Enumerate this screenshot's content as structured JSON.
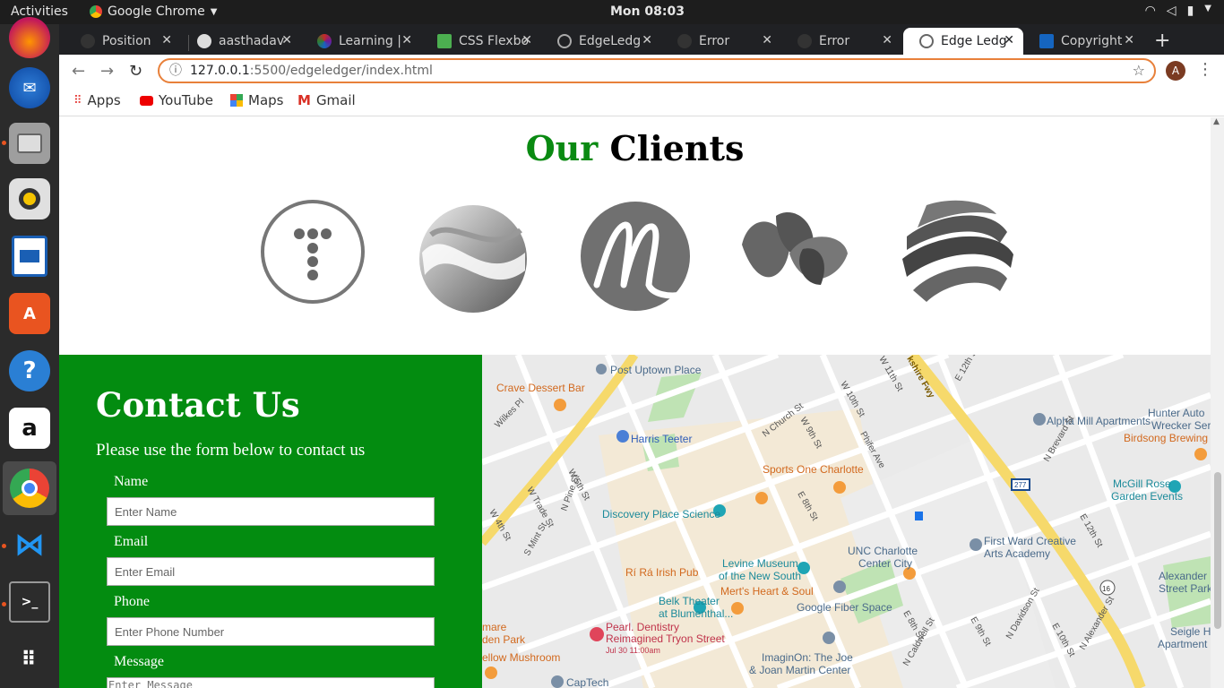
{
  "topbar": {
    "activities": "Activities",
    "app_name": "Google Chrome",
    "clock": "Mon 08:03"
  },
  "dock": {
    "items": [
      "firefox-icon",
      "thunderbird-icon",
      "files-icon",
      "rhythmbox-icon",
      "writer-icon",
      "software-icon",
      "help-icon",
      "amazon-icon",
      "chrome-icon",
      "vscode-icon",
      "terminal-icon",
      "show-apps-icon"
    ]
  },
  "tabs": [
    {
      "title": "Position"
    },
    {
      "title": "aasthadav"
    },
    {
      "title": "Learning |"
    },
    {
      "title": "CSS Flexbo"
    },
    {
      "title": "EdgeLedg"
    },
    {
      "title": "Error"
    },
    {
      "title": "Error"
    },
    {
      "title": "Edge Ledg"
    },
    {
      "title": "Copyright"
    }
  ],
  "omnibar": {
    "url_host": "127.0.0.1",
    "url_rest": ":5500/edgeledger/index.html",
    "profile_initial": "A"
  },
  "bookmarks": {
    "apps": "Apps",
    "youtube": "YouTube",
    "maps": "Maps",
    "gmail": "Gmail"
  },
  "clients": {
    "title_accent": "Our",
    "title_rest": "Clients",
    "logos": [
      "t-dots-logo",
      "wave-sphere-logo",
      "script-m-logo",
      "leaves-logo",
      "striped-globe-logo"
    ]
  },
  "contact": {
    "heading": "Contact Us",
    "subtitle": "Please use the form below to contact us",
    "name_label": "Name",
    "name_placeholder": "Enter Name",
    "email_label": "Email",
    "email_placeholder": "Enter Email",
    "phone_label": "Phone",
    "phone_placeholder": "Enter Phone Number",
    "message_label": "Message",
    "message_placeholder": "Enter Message"
  },
  "map": {
    "labels": {
      "post_uptown": "Post Uptown Place",
      "crave": "Crave Dessert Bar",
      "harris": "Harris Teeter",
      "sports_one": "Sports One Charlotte",
      "discovery": "Discovery Place Science",
      "alpha_mill": "Alpha Mill Apartments",
      "hunter1": "Hunter Auto",
      "hunter2": "Wrecker Serv",
      "birdsong": "Birdsong Brewing C",
      "mcgill1": "McGill Rose",
      "mcgill2": "Garden Events",
      "first_ward1": "First Ward Creative",
      "first_ward2": "Arts Academy",
      "unc1": "UNC Charlotte",
      "unc2": "Center City",
      "ri_ra": "Rí Rá Irish Pub",
      "levine1": "Levine Museum",
      "levine2": "of the New South",
      "merts": "Mert's Heart & Soul",
      "belk1": "Belk Theater",
      "belk2": "at Blumenthal...",
      "pearl1": "Pearl. Dentistry",
      "pearl2": "Reimagined Tryon Street",
      "pearl3": "Jul 30 11:00am",
      "fiber": "Google Fiber Space",
      "imagine1": "ImaginOn: The Joe",
      "imagine2": "& Joan Martin Center",
      "alexander1": "Alexander",
      "alexander2": "Street Park",
      "seigle1": "Seigle Ho",
      "seigle2": "Apartment Hom",
      "mare1": "mare",
      "mare2": "den Park",
      "mushroom": "ellow Mushroom",
      "captech": "CapTech",
      "st_church": "N Church St",
      "st_5th": "W 5th St",
      "st_trade": "W Trade St",
      "st_4th": "W 4th St",
      "st_mint": "S Mint St",
      "st_pine": "N Pine St",
      "st_11th": "W 11th St",
      "st_12th": "E 12th St",
      "st_12th_b": "E 12th St",
      "st_9th": "W 9th St",
      "st_10th": "W 10th St",
      "st_phifer": "Phifer Ave",
      "st_8th": "E 8th St",
      "st_brevard": "N Brevard St",
      "st_davidson": "N Davidson St",
      "st_caldwell": "N Caldwell St",
      "st_10th_e": "E 10th St",
      "st_9th_e": "E 9th St",
      "st_8th_e": "E 8th St",
      "st_alexander": "N Alexander St",
      "st_wilkes": "Wilkes Pl",
      "fwy": "kshire Fwy",
      "route_277": "277",
      "route_16": "16"
    }
  }
}
